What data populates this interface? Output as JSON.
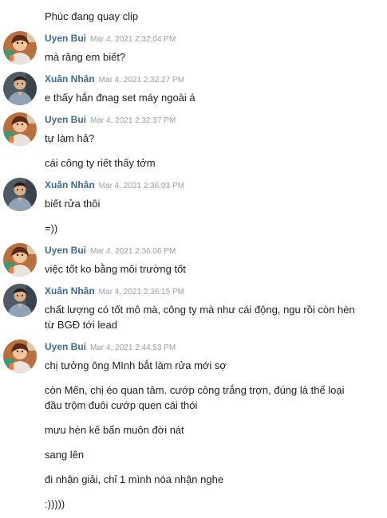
{
  "chat": {
    "blocks": [
      {
        "type": "text",
        "text": "Phúc đang quay clip"
      },
      {
        "type": "header",
        "author": "Uyen Bui",
        "time": "Mar 4, 2021 2:32:04 PM",
        "avatar": "uyen-avatar"
      },
      {
        "type": "text",
        "text": "mà răng em biết?"
      },
      {
        "type": "header",
        "author": "Xuân Nhân",
        "time": "Mar 4, 2021 2:32:27 PM",
        "avatar": "nhan-avatar"
      },
      {
        "type": "text",
        "text": "e thấy hắn đnag set máy ngoài á"
      },
      {
        "type": "header",
        "author": "Uyen Bui",
        "time": "Mar 4, 2021 2:32:37 PM",
        "avatar": "uyen-avatar"
      },
      {
        "type": "text",
        "text": "tự làm hả?"
      },
      {
        "type": "text",
        "text": "cái công ty riết thấy tởm"
      },
      {
        "type": "header",
        "author": "Xuân Nhân",
        "time": "Mar 4, 2021 2:36:03 PM",
        "avatar": "nhan-avatar"
      },
      {
        "type": "text",
        "text": "biết rửa thôi"
      },
      {
        "type": "text",
        "text": "=))"
      },
      {
        "type": "header",
        "author": "Uyen Bui",
        "time": "Mar 4, 2021 2:36:06 PM",
        "avatar": "uyen-avatar"
      },
      {
        "type": "text",
        "text": "việc tốt ko bằng môi trường tốt"
      },
      {
        "type": "header",
        "author": "Xuân Nhân",
        "time": "Mar 4, 2021 2:36:15 PM",
        "avatar": "nhan-avatar"
      },
      {
        "type": "text",
        "text": "chất lượng có tốt mô mà, công ty mà như cái động, ngu rồi còn hèn từ BGĐ tới lead"
      },
      {
        "type": "header",
        "author": "Uyen Bui",
        "time": "Mar 4, 2021 2:44:53 PM",
        "avatar": "uyen-avatar"
      },
      {
        "type": "text",
        "text": "chị tưởng ông MInh bắt làm rửa mới sợ"
      },
      {
        "type": "text",
        "text": "còn Mến, chị éo quan tâm. cướp công trắng trợn, đúng là thể loại đầu trộm đuôi cướp quen cái thói"
      },
      {
        "type": "text",
        "text": "mưu hèn kế bẩn muôn đời nát"
      },
      {
        "type": "text",
        "text": "sang lên"
      },
      {
        "type": "text",
        "text": "đi nhận giải, chỉ 1 mình nóa nhận nghe"
      },
      {
        "type": "text",
        "text": ":)))))"
      }
    ]
  },
  "colors": {
    "author": "#3d6a93",
    "timestamp": "#9aa0a6",
    "text": "#1d1d1d"
  }
}
